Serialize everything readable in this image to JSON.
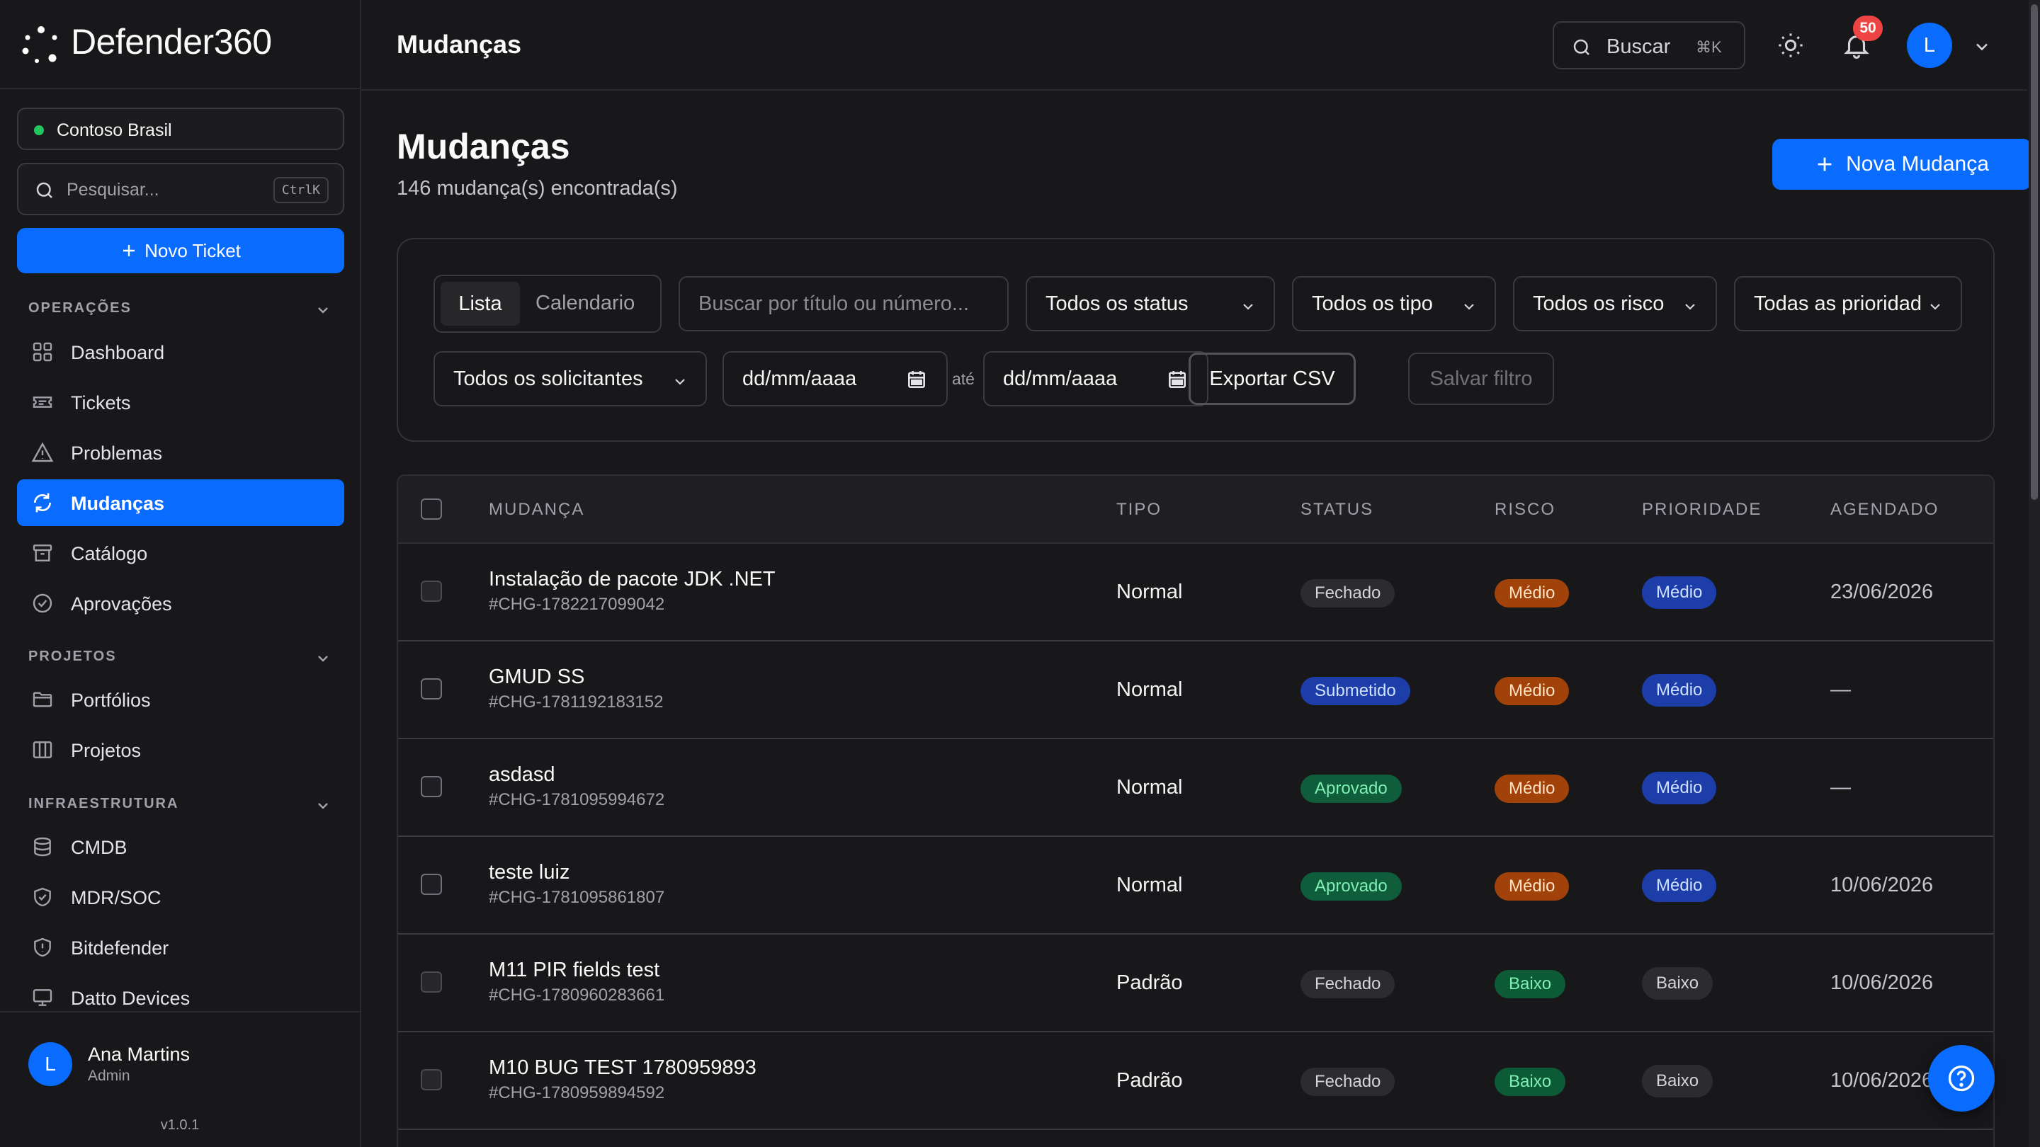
{
  "app": {
    "name": "Defender360",
    "version": "v1.0.1"
  },
  "sidebar": {
    "org": "Contoso Brasil",
    "search_placeholder": "Pesquisar...",
    "search_shortcut": "CtrlK",
    "new_ticket": "Novo Ticket",
    "sections": [
      {
        "title": "OPERAÇÕES",
        "items": [
          {
            "label": "Dashboard",
            "icon": "dashboard-icon"
          },
          {
            "label": "Tickets",
            "icon": "ticket-icon"
          },
          {
            "label": "Problemas",
            "icon": "warning-icon"
          },
          {
            "label": "Mudanças",
            "icon": "refresh-icon",
            "active": true
          },
          {
            "label": "Catálogo",
            "icon": "archive-icon"
          },
          {
            "label": "Aprovações",
            "icon": "check-circle-icon"
          }
        ]
      },
      {
        "title": "PROJETOS",
        "items": [
          {
            "label": "Portfólios",
            "icon": "folder-icon"
          },
          {
            "label": "Projetos",
            "icon": "columns-icon"
          }
        ]
      },
      {
        "title": "INFRAESTRUTURA",
        "items": [
          {
            "label": "CMDB",
            "icon": "database-icon"
          },
          {
            "label": "MDR/SOC",
            "icon": "shield-check-icon"
          },
          {
            "label": "Bitdefender",
            "icon": "shield-icon"
          },
          {
            "label": "Datto Devices",
            "icon": "monitor-icon"
          }
        ]
      }
    ],
    "user": {
      "initial": "L",
      "name": "Ana Martins",
      "role": "Admin"
    }
  },
  "topbar": {
    "title": "Mudanças",
    "search_label": "Buscar",
    "search_shortcut": "⌘K",
    "notifications": "50",
    "avatar_initial": "L"
  },
  "page": {
    "title": "Mudanças",
    "subtitle": "146 mudança(s) encontrada(s)",
    "new_button": "Nova Mudança"
  },
  "filters": {
    "view_list": "Lista",
    "view_calendar": "Calendario",
    "search_placeholder": "Buscar por título ou número...",
    "status": "Todos os status",
    "tipo": "Todos os tipo",
    "risco": "Todos os risco",
    "prioridade": "Todas as prioridades",
    "solicitantes": "Todos os solicitantes",
    "date_from": "dd/mm/aaaa",
    "ate": "até",
    "date_to": "dd/mm/aaaa",
    "export": "Exportar CSV",
    "save": "Salvar filtro"
  },
  "table": {
    "columns": [
      "MUDANÇA",
      "TIPO",
      "STATUS",
      "RISCO",
      "PRIORIDADE",
      "AGENDADO"
    ],
    "rows": [
      {
        "title": "Instalação de pacote JDK .NET",
        "number": "#CHG-1782217099042",
        "tipo": "Normal",
        "status": "Fechado",
        "status_kind": "fechado",
        "risco": "Médio",
        "risco_kind": "medio",
        "prioridade": "Médio",
        "prio_kind": "medio",
        "agendado": "23/06/2026",
        "checkbox_enabled": false
      },
      {
        "title": "GMUD SS",
        "number": "#CHG-1781192183152",
        "tipo": "Normal",
        "status": "Submetido",
        "status_kind": "submetido",
        "risco": "Médio",
        "risco_kind": "medio",
        "prioridade": "Médio",
        "prio_kind": "medio",
        "agendado": "—",
        "checkbox_enabled": true
      },
      {
        "title": "asdasd",
        "number": "#CHG-1781095994672",
        "tipo": "Normal",
        "status": "Aprovado",
        "status_kind": "aprovado",
        "risco": "Médio",
        "risco_kind": "medio",
        "prioridade": "Médio",
        "prio_kind": "medio",
        "agendado": "—",
        "checkbox_enabled": true
      },
      {
        "title": "teste luiz",
        "number": "#CHG-1781095861807",
        "tipo": "Normal",
        "status": "Aprovado",
        "status_kind": "aprovado",
        "risco": "Médio",
        "risco_kind": "medio",
        "prioridade": "Médio",
        "prio_kind": "medio",
        "agendado": "10/06/2026",
        "checkbox_enabled": true
      },
      {
        "title": "M11 PIR fields test",
        "number": "#CHG-1780960283661",
        "tipo": "Padrão",
        "status": "Fechado",
        "status_kind": "fechado",
        "risco": "Baixo",
        "risco_kind": "baixo",
        "prioridade": "Baixo",
        "prio_kind": "baixo",
        "agendado": "10/06/2026",
        "checkbox_enabled": false
      },
      {
        "title": "M10 BUG TEST 1780959893",
        "number": "#CHG-1780959894592",
        "tipo": "Padrão",
        "status": "Fechado",
        "status_kind": "fechado",
        "risco": "Baixo",
        "risco_kind": "baixo",
        "prioridade": "Baixo",
        "prio_kind": "baixo",
        "agendado": "10/06/2026",
        "checkbox_enabled": false
      }
    ]
  },
  "colors": {
    "accent": "#0a6cff",
    "background": "#18181b",
    "danger": "#ef4444"
  }
}
